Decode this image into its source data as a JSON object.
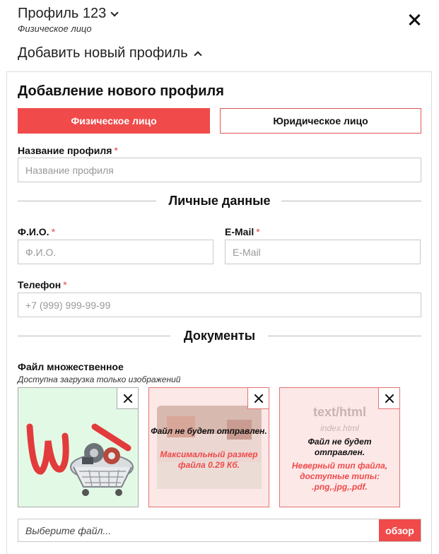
{
  "header": {
    "profile_title": "Профиль 123",
    "profile_subtitle": "Физическое лицо",
    "add_profile_toggle": "Добавить новый профиль"
  },
  "form": {
    "title": "Добавление нового профиля",
    "type_individual": "Физическое лицо",
    "type_legal": "Юридическое лицо",
    "active_type": "Физическое лицо",
    "profile_name": {
      "label": "Название профиля",
      "placeholder": "Название профиля",
      "required": "*"
    },
    "personal_section": "Личные данные",
    "fio": {
      "label": "Ф.И.О.",
      "placeholder": "Ф.И.О.",
      "required": "*"
    },
    "email": {
      "label": "E-Mail",
      "placeholder": "E-Mail",
      "required": "*"
    },
    "phone": {
      "label": "Телефон",
      "placeholder": "+7 (999) 999-99-99",
      "required": "*"
    },
    "documents_section": "Документы",
    "files": {
      "label": "Файл множественное",
      "hint": "Доступна загрузка только изображений",
      "tiles": [
        {
          "status": "ok"
        },
        {
          "status": "error",
          "message": "Файл не будет отправлен.",
          "reason": "Максимальный размер файла 0.29 Кб."
        },
        {
          "status": "error",
          "file_type": "text/html",
          "file_name": "index.html",
          "message": "Файл не будет отправлен.",
          "reason": "Неверный тип файла, доступные типы: .png,.jpg,.pdf."
        }
      ],
      "picker_placeholder": "Выберите файл...",
      "browse_label": "обзор"
    }
  },
  "colors": {
    "accent": "#f04a4a",
    "ok_bg": "#e2f9e6",
    "err_bg": "#fde8e8"
  }
}
